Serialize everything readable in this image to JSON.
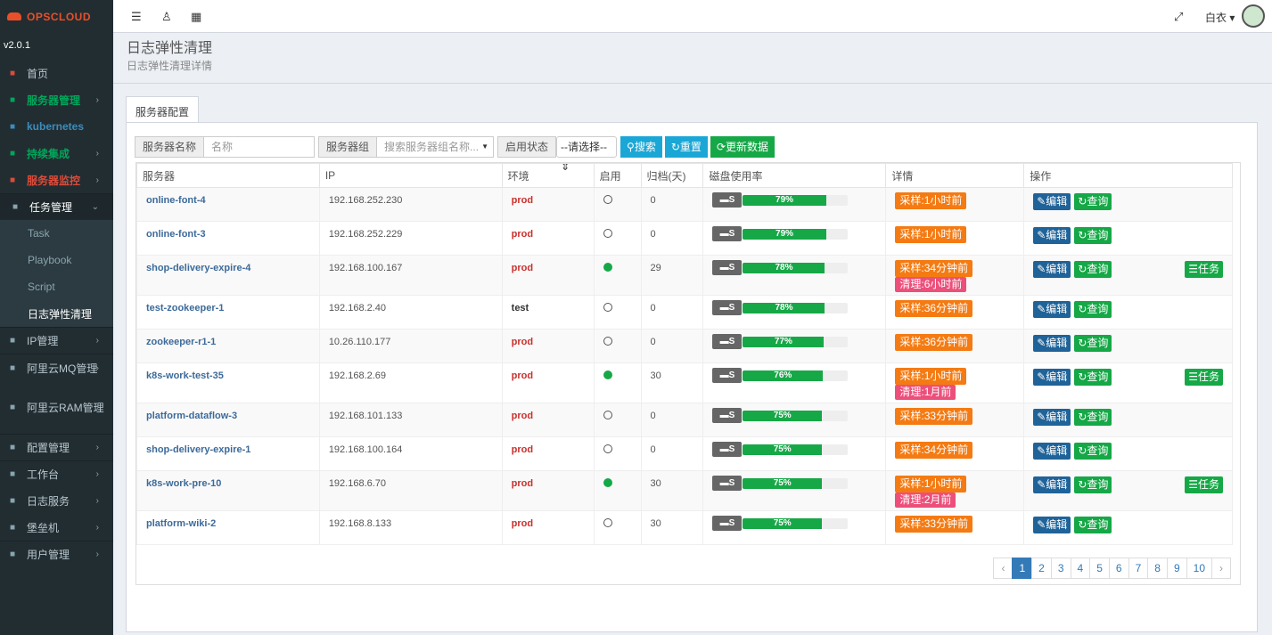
{
  "app": {
    "brand": "OPSCLOUD",
    "version": "v2.0.1"
  },
  "topbar": {
    "user": "白衣"
  },
  "sidebar": {
    "items": [
      {
        "label": "首页",
        "icon": "dashboard-icon",
        "color": "#dd4b39"
      },
      {
        "label": "服务器管理",
        "icon": "windows-icon",
        "color": "#00a65a"
      },
      {
        "label": "kubernetes",
        "icon": "kubernetes-icon",
        "color": "#3c8dbc"
      },
      {
        "label": "持续集成",
        "icon": "sync-icon",
        "color": "#00a65a"
      },
      {
        "label": "服务器监控",
        "icon": "monitor-icon",
        "color": "#dd4b39"
      },
      {
        "label": "任务管理",
        "icon": "task-icon"
      },
      {
        "label": "Task"
      },
      {
        "label": "Playbook"
      },
      {
        "label": "Script"
      },
      {
        "label": "日志弹性清理"
      },
      {
        "label": "IP管理",
        "icon": "ip-icon"
      },
      {
        "label": "阿里云MQ管理",
        "icon": "mq-icon"
      },
      {
        "label": "阿里云RAM管理",
        "icon": "ram-icon"
      },
      {
        "label": "配置管理",
        "icon": "config-icon"
      },
      {
        "label": "工作台",
        "icon": "workbench-icon"
      },
      {
        "label": "日志服务",
        "icon": "log-icon"
      },
      {
        "label": "堡垒机",
        "icon": "bastion-icon"
      },
      {
        "label": "用户管理",
        "icon": "user-icon"
      }
    ]
  },
  "page": {
    "title": "日志弹性清理",
    "subtitle": "日志弹性清理详情",
    "tab": "服务器配置"
  },
  "filter": {
    "server_name_label": "服务器名称",
    "server_name_placeholder": "名称",
    "group_label": "服务器组",
    "group_placeholder": "搜索服务器组名称...",
    "status_label": "启用状态",
    "status_select": "--请选择--",
    "search_btn": "搜索",
    "reset_btn": "重置",
    "update_btn": "更新数据"
  },
  "table": {
    "headers": [
      "服务器",
      "IP",
      "环境",
      "启用",
      "归档(天)",
      "磁盘使用率",
      "详情",
      "操作"
    ],
    "rows": [
      {
        "server": "online-font-4",
        "ip": "192.168.252.230",
        "env": "prod",
        "enabled": false,
        "archive": "0",
        "disk": 79,
        "disk_label": "79%",
        "sample": "采样:1小时前",
        "clean": "",
        "task": false
      },
      {
        "server": "online-font-3",
        "ip": "192.168.252.229",
        "env": "prod",
        "enabled": false,
        "archive": "0",
        "disk": 79,
        "disk_label": "79%",
        "sample": "采样:1小时前",
        "clean": "",
        "task": false
      },
      {
        "server": "shop-delivery-expire-4",
        "ip": "192.168.100.167",
        "env": "prod",
        "enabled": true,
        "archive": "29",
        "disk": 78,
        "disk_label": "78%",
        "sample": "采样:34分钟前",
        "clean": "清理:6小时前",
        "task": true
      },
      {
        "server": "test-zookeeper-1",
        "ip": "192.168.2.40",
        "env": "test",
        "enabled": false,
        "archive": "0",
        "disk": 78,
        "disk_label": "78%",
        "sample": "采样:36分钟前",
        "clean": "",
        "task": false
      },
      {
        "server": "zookeeper-r1-1",
        "ip": "10.26.110.177",
        "env": "prod",
        "enabled": false,
        "archive": "0",
        "disk": 77,
        "disk_label": "77%",
        "sample": "采样:36分钟前",
        "clean": "",
        "task": false
      },
      {
        "server": "k8s-work-test-35",
        "ip": "192.168.2.69",
        "env": "prod",
        "enabled": true,
        "archive": "30",
        "disk": 76,
        "disk_label": "76%",
        "sample": "采样:1小时前",
        "clean": "清理:1月前",
        "task": true
      },
      {
        "server": "platform-dataflow-3",
        "ip": "192.168.101.133",
        "env": "prod",
        "enabled": false,
        "archive": "0",
        "disk": 75,
        "disk_label": "75%",
        "sample": "采样:33分钟前",
        "clean": "",
        "task": false
      },
      {
        "server": "shop-delivery-expire-1",
        "ip": "192.168.100.164",
        "env": "prod",
        "enabled": false,
        "archive": "0",
        "disk": 75,
        "disk_label": "75%",
        "sample": "采样:34分钟前",
        "clean": "",
        "task": false
      },
      {
        "server": "k8s-work-pre-10",
        "ip": "192.168.6.70",
        "env": "prod",
        "enabled": true,
        "archive": "30",
        "disk": 75,
        "disk_label": "75%",
        "sample": "采样:1小时前",
        "clean": "清理:2月前",
        "task": true
      },
      {
        "server": "platform-wiki-2",
        "ip": "192.168.8.133",
        "env": "prod",
        "enabled": false,
        "archive": "30",
        "disk": 75,
        "disk_label": "75%",
        "sample": "采样:33分钟前",
        "clean": "",
        "task": false
      }
    ],
    "actions": {
      "edit": "编辑",
      "query": "查询",
      "task": "任务",
      "disk_tag": "S"
    }
  },
  "pagination": {
    "prev": "‹",
    "next": "›",
    "pages": [
      "1",
      "2",
      "3",
      "4",
      "5",
      "6",
      "7",
      "8",
      "9",
      "10"
    ],
    "current": "1"
  }
}
